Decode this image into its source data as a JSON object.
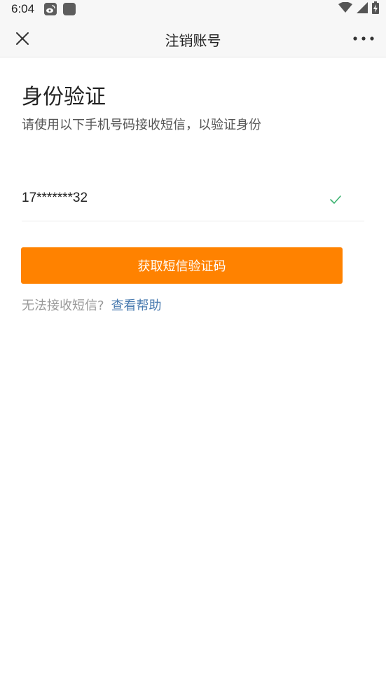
{
  "status_bar": {
    "time": "6:04",
    "icons": [
      "weibo-icon",
      "app-square-icon",
      "wifi-icon",
      "signal-icon",
      "battery-charging-icon"
    ]
  },
  "nav": {
    "title": "注销账号",
    "close_icon": "close-icon",
    "more_icon": "more-icon"
  },
  "content": {
    "title": "身份验证",
    "subtitle": "请使用以下手机号码接收短信，以验证身份",
    "phone": "17*******32",
    "button_label": "获取短信验证码",
    "help_prefix": "无法接收短信?",
    "help_link": "查看帮助"
  },
  "colors": {
    "accent": "#ff8200",
    "link": "#4a7bb0",
    "check": "#3cb371"
  }
}
